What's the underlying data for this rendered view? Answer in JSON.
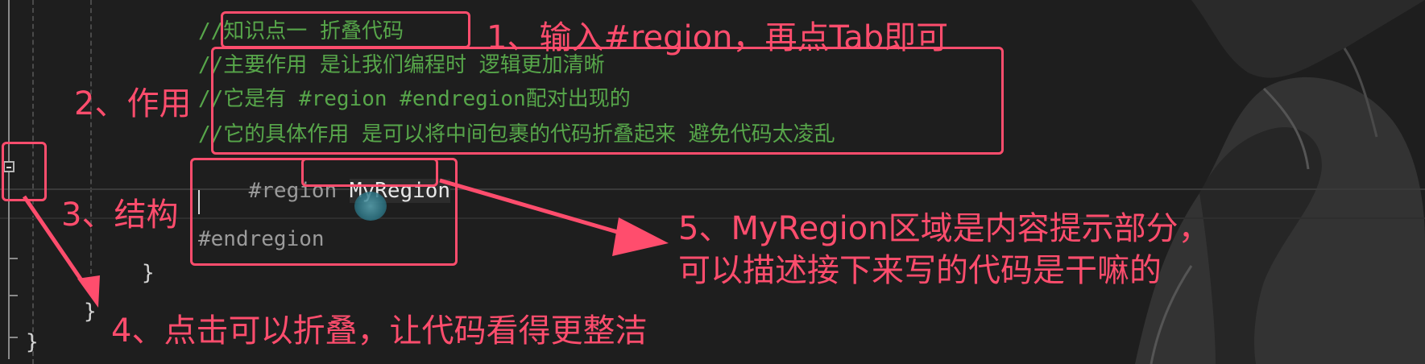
{
  "editor": {
    "lines": {
      "comment1": "//知识点一 折叠代码",
      "comment2": "//主要作用 是让我们编程时 逻辑更加清晰",
      "comment3": "//它是有 #region #endregion配对出现的",
      "comment4": "//它的具体作用 是可以将中间包裹的代码折叠起来 避免代码太凌乱",
      "region_keyword": "#region",
      "region_name": "MyRegion",
      "endregion_keyword": "#endregion",
      "brace_inner": "}",
      "brace_middle": "}",
      "brace_outer": "}"
    }
  },
  "annotations": {
    "step1": "1、输入#region，再点Tab即可",
    "step2": "2、作用",
    "step3": "3、结构",
    "step4": "4、点击可以折叠，让代码看得更整洁",
    "step5_line1": "5、MyRegion区域是内容提示部分，",
    "step5_line2": "可以描述接下来写的代码是干嘛的"
  },
  "colors": {
    "annotation": "#ff4d6d",
    "comment": "#57a64a",
    "background": "#1e1e1e"
  },
  "icons": [
    "fold-collapse-icon",
    "mouse-cursor-icon",
    "arrow-icon"
  ]
}
